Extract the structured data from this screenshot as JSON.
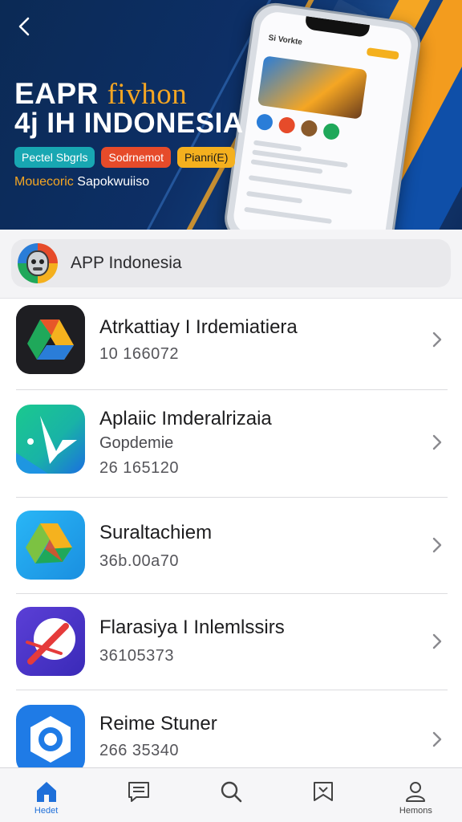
{
  "hero": {
    "title_line1_prefix": "EAPR",
    "title_line1_accent": "fivhon",
    "title_line2": "4⁠j IH INDONESIA",
    "chips": [
      "Pectel Sbgrls",
      "Sodrnemot",
      "Pianri(E)"
    ],
    "subtitle_a": "Mouecoric",
    "subtitle_b": "Sapokwuiiso",
    "phone_title": "Si Vorkte"
  },
  "search": {
    "text": "APP Indonesia"
  },
  "apps": [
    {
      "name": "Atrkattiay I Irdemiatiera",
      "subtitle": "",
      "meta": "10 166072",
      "icon": "drive-dark-icon"
    },
    {
      "name": "Aplaiic Imderalrizaia",
      "subtitle": "Gopdemie",
      "meta": "26 165120",
      "icon": "green-arrow-icon"
    },
    {
      "name": "Suraltachiem",
      "subtitle": "",
      "meta": "36b.00a70",
      "icon": "drive-blue-icon"
    },
    {
      "name": "Flarasiya I Inlemlssirs",
      "subtitle": "",
      "meta": "36105373",
      "icon": "slash-purple-icon"
    },
    {
      "name": "Reime Stuner",
      "subtitle": "",
      "meta": "266 35340",
      "icon": "blue-ring-icon"
    }
  ],
  "tabs": [
    {
      "label": "Hedet",
      "icon": "home-icon",
      "active": true
    },
    {
      "label": "",
      "icon": "news-icon",
      "active": false
    },
    {
      "label": "",
      "icon": "search-icon",
      "active": false
    },
    {
      "label": "",
      "icon": "bookmark-icon",
      "active": false
    },
    {
      "label": "Hemons",
      "icon": "profile-icon",
      "active": false
    }
  ],
  "colors": {
    "accent_orange": "#f5a623",
    "hero_navy": "#0d2f66",
    "active_tab": "#1e6fd9"
  }
}
